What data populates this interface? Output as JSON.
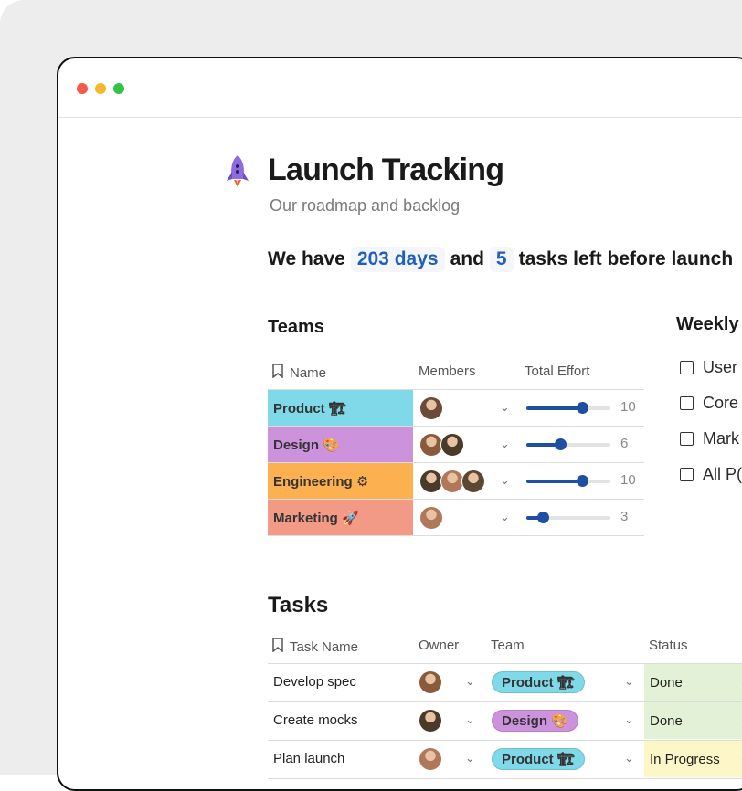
{
  "page": {
    "title": "Launch Tracking",
    "subtitle": "Our roadmap and backlog",
    "icon": "rocket-icon"
  },
  "summary": {
    "prefix": "We have",
    "days": "203 days",
    "middle": "and",
    "tasks_count": "5",
    "suffix": "tasks left before launch"
  },
  "teams": {
    "heading": "Teams",
    "columns": [
      "Name",
      "Members",
      "Total Effort"
    ],
    "rows": [
      {
        "name": "Product 🏗",
        "color": "#7fd9e8",
        "members": 1,
        "effort": "10",
        "effort_value": 10
      },
      {
        "name": "Design 🎨",
        "color": "#cc92dc",
        "members": 2,
        "effort": "6",
        "effort_value": 6
      },
      {
        "name": "Engineering ⚙",
        "color": "#fcb04f",
        "members": 3,
        "effort": "10",
        "effort_value": 10
      },
      {
        "name": "Marketing 🚀",
        "color": "#f29a86",
        "members": 1,
        "effort": "3",
        "effort_value": 3
      }
    ],
    "effort_max": 15
  },
  "weekly": {
    "heading": "Weekly",
    "items": [
      "User",
      "Core",
      "Mark",
      "All P("
    ]
  },
  "tasks": {
    "heading": "Tasks",
    "columns": [
      "Task Name",
      "Owner",
      "Team",
      "Status"
    ],
    "rows": [
      {
        "name": "Develop spec",
        "team": "Product 🏗",
        "team_color": "#7fd9e8",
        "status": "Done",
        "status_color": "#e3f2d6"
      },
      {
        "name": "Create mocks",
        "team": "Design 🎨",
        "team_color": "#cc92dc",
        "status": "Done",
        "status_color": "#e3f2d6"
      },
      {
        "name": "Plan launch",
        "team": "Product 🏗",
        "team_color": "#7fd9e8",
        "status": "In Progress",
        "status_color": "#fdf7c8"
      }
    ]
  },
  "colors": {
    "accent_link": "#1f5fbf",
    "slider": "#1e4fa3"
  }
}
